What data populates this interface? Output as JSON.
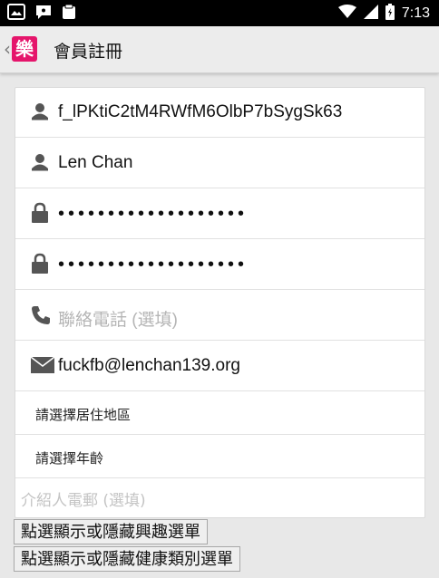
{
  "status_bar": {
    "time": "7:13"
  },
  "action_bar": {
    "back_icon": "‹",
    "logo_char": "樂",
    "title": "會員註冊"
  },
  "form": {
    "username": {
      "icon": "person-icon",
      "value": "f_lPKtiC2tM4RWfM6OlbP7bSygSk63"
    },
    "display_name": {
      "icon": "person-icon",
      "value": "Len Chan"
    },
    "password": {
      "icon": "lock-icon",
      "value": "•••••••••••••••••••"
    },
    "password_confirm": {
      "icon": "lock-icon",
      "value": "•••••••••••••••••••"
    },
    "phone": {
      "icon": "phone-icon",
      "placeholder": "聯絡電話 (選填)"
    },
    "email": {
      "icon": "envelope-icon",
      "value": "fuckfb@lenchan139.org"
    },
    "region_select": "請選擇居住地區",
    "age_select": "請選擇年齡",
    "referrer_email": {
      "placeholder": "介紹人電郵 (選填)"
    }
  },
  "buttons": {
    "toggle_interests": "點選顯示或隱藏興趣選單",
    "toggle_health": "點選顯示或隱藏健康類別選單"
  }
}
